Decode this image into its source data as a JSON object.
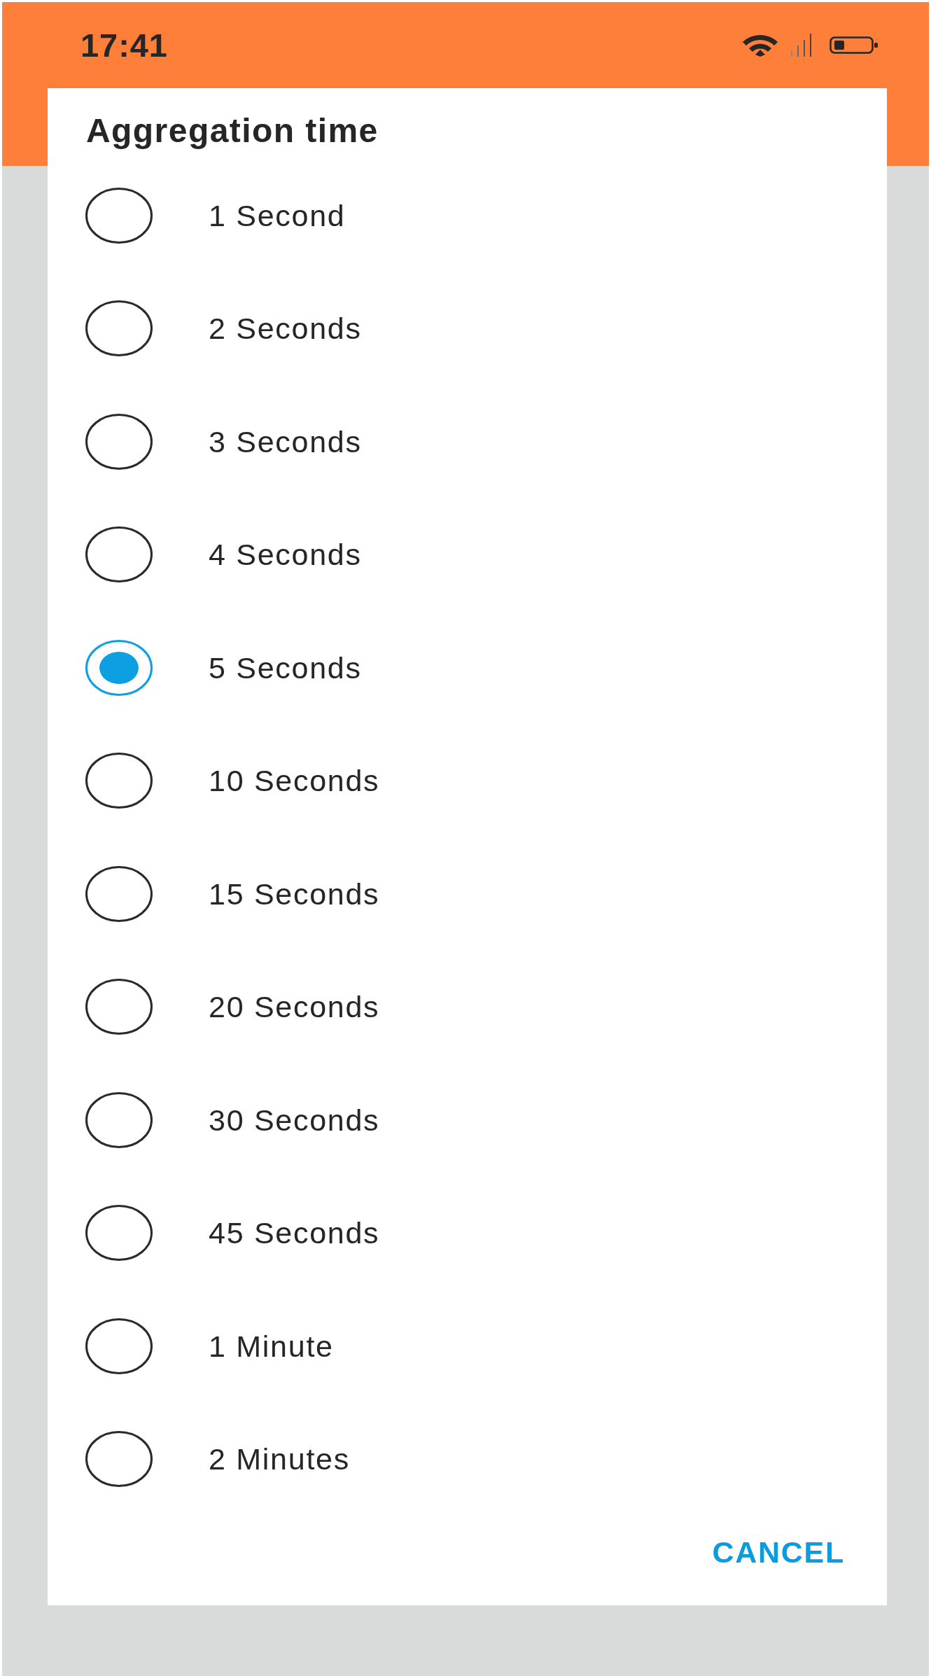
{
  "status_bar": {
    "time": "17:41"
  },
  "dialog": {
    "title": "Aggregation time",
    "options": [
      {
        "label": "1 Second",
        "selected": false
      },
      {
        "label": "2 Seconds",
        "selected": false
      },
      {
        "label": "3 Seconds",
        "selected": false
      },
      {
        "label": "4 Seconds",
        "selected": false
      },
      {
        "label": "5 Seconds",
        "selected": true
      },
      {
        "label": "10 Seconds",
        "selected": false
      },
      {
        "label": "15 Seconds",
        "selected": false
      },
      {
        "label": "20 Seconds",
        "selected": false
      },
      {
        "label": "30 Seconds",
        "selected": false
      },
      {
        "label": "45 Seconds",
        "selected": false
      },
      {
        "label": "1 Minute",
        "selected": false
      },
      {
        "label": "2 Minutes",
        "selected": false
      }
    ],
    "cancel_button": {
      "label": "CANCEL"
    }
  }
}
